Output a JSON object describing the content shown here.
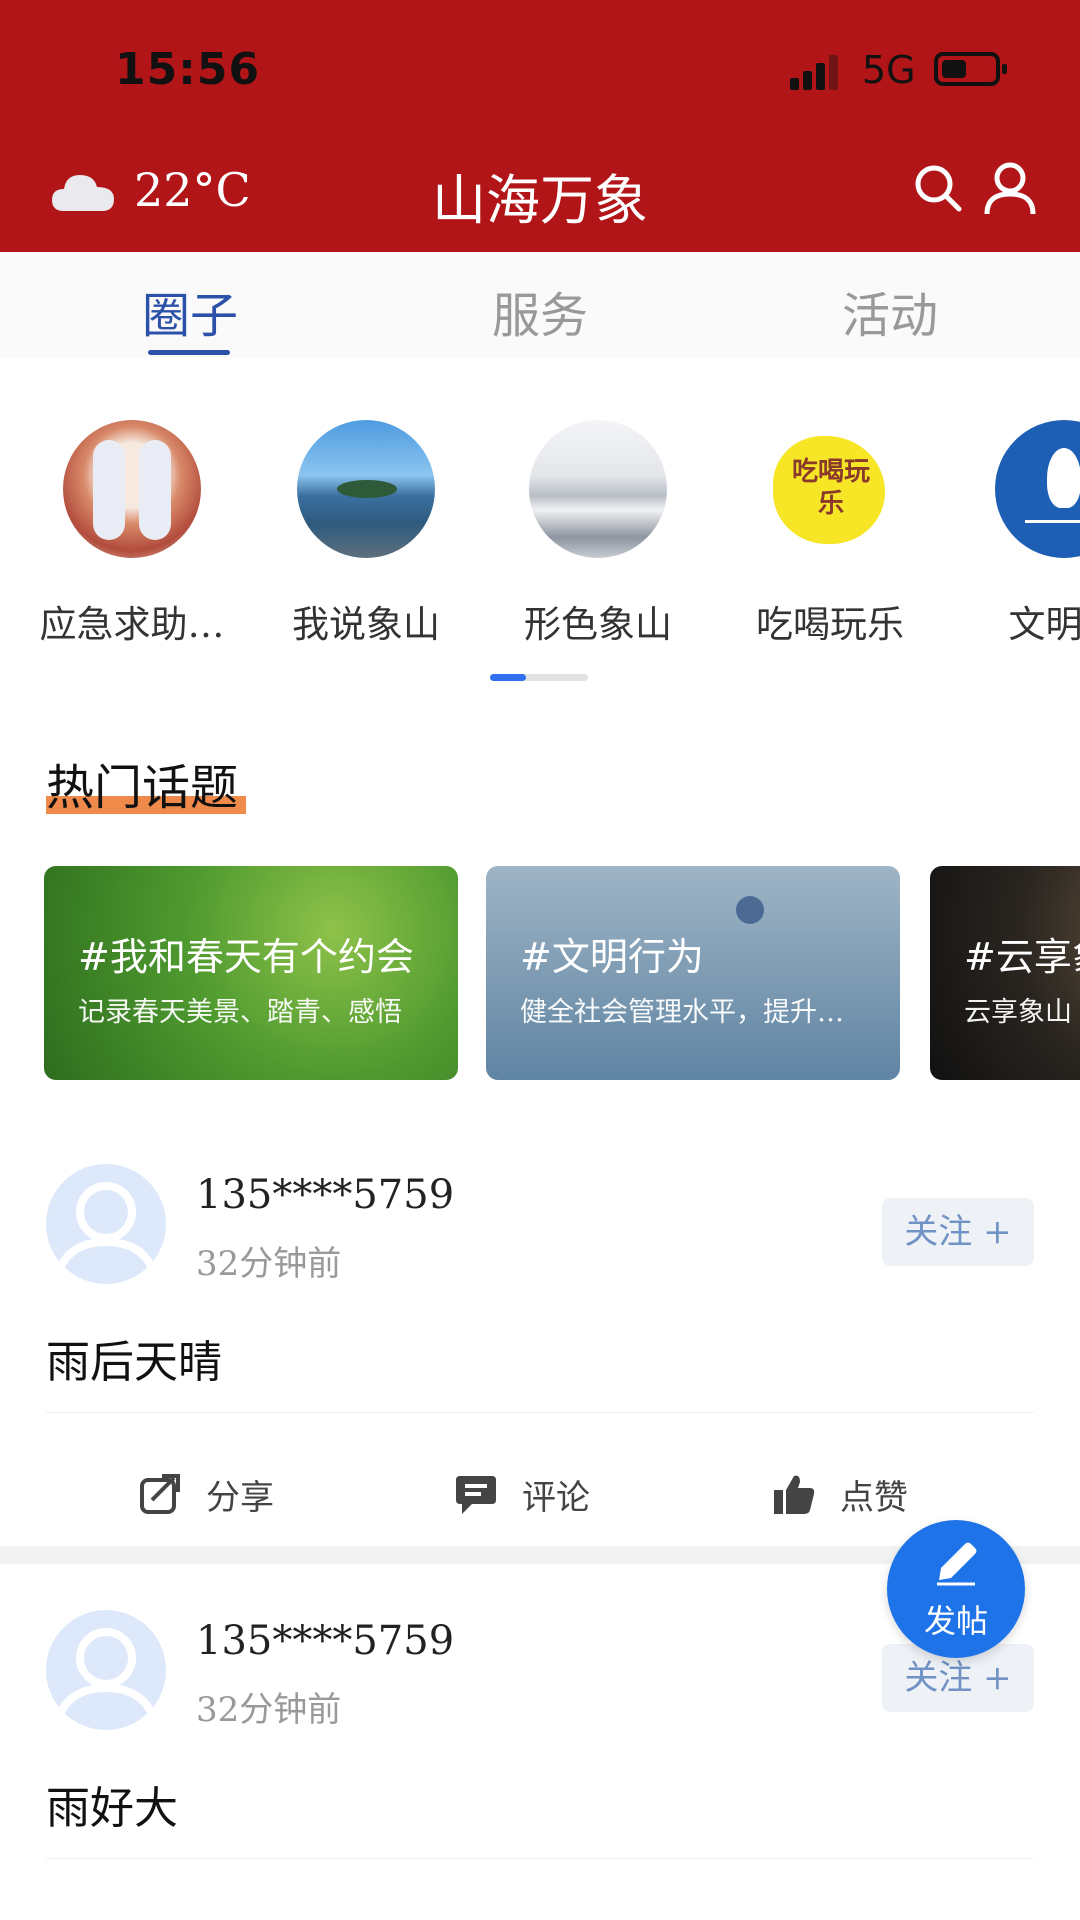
{
  "status_bar": {
    "time": "15:56",
    "network": "5G"
  },
  "header": {
    "weather_icon": "cloud-icon",
    "temperature": "22°C",
    "title": "山海万象",
    "icons": [
      "search-icon",
      "user-icon"
    ]
  },
  "tabs": [
    {
      "label": "圈子",
      "active": true
    },
    {
      "label": "服务",
      "active": false
    },
    {
      "label": "活动",
      "active": false
    }
  ],
  "circles": [
    {
      "label": "应急求助…"
    },
    {
      "label": "我说象山"
    },
    {
      "label": "形色象山"
    },
    {
      "label": "吃喝玩乐",
      "logo_text": "吃喝玩乐"
    },
    {
      "label": "文明啄"
    }
  ],
  "hot_topics": {
    "title": "热门话题",
    "items": [
      {
        "title": "#我和春天有个约会",
        "desc": "记录春天美景、踏青、感悟"
      },
      {
        "title": "#文明行为",
        "desc": "健全社会管理水平，提升…"
      },
      {
        "title": "#云享象",
        "desc": "云享象山"
      }
    ]
  },
  "posts": [
    {
      "user": "135****5759",
      "time": "32分钟前",
      "follow": "关注 +",
      "text": "雨后天晴"
    },
    {
      "user": "135****5759",
      "time": "32分钟前",
      "follow": "关注 +",
      "text": "雨好大"
    }
  ],
  "actions": {
    "share": "分享",
    "comment": "评论",
    "like": "点赞"
  },
  "fab": {
    "label": "发帖"
  },
  "colors": {
    "header": "#b21518",
    "accent": "#2b52a8",
    "fab": "#1f73e8",
    "highlight": "#f08a4b"
  }
}
